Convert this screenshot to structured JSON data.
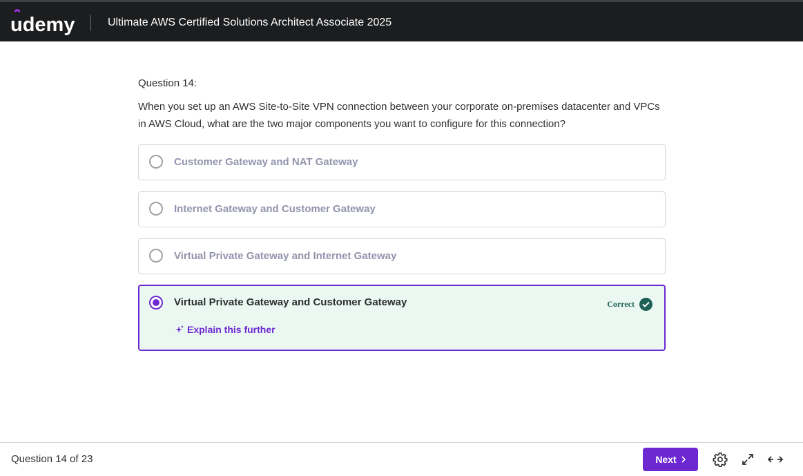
{
  "header": {
    "logo_text": "ūdemy",
    "course_title": "Ultimate AWS Certified Solutions Architect Associate 2025"
  },
  "question": {
    "label": "Question 14:",
    "text": "When you set up an AWS Site-to-Site VPN connection between your corporate on-premises datacenter and VPCs in AWS Cloud, what are the two major components you want to configure for this connection?"
  },
  "options": [
    {
      "label": "Customer Gateway and NAT Gateway",
      "selected": false
    },
    {
      "label": "Internet Gateway and Customer Gateway",
      "selected": false
    },
    {
      "label": "Virtual Private Gateway and Internet Gateway",
      "selected": false
    },
    {
      "label": "Virtual Private Gateway and Customer Gateway",
      "selected": true,
      "status": "Correct",
      "explain_link": "Explain this further"
    }
  ],
  "footer": {
    "progress": "Question 14 of 23",
    "next_label": "Next",
    "icons": [
      "gear-icon",
      "expand-icon",
      "horizontal-arrows-icon"
    ]
  },
  "colors": {
    "accent": "#6d28d2",
    "correct": "#1e6055",
    "correct_bg": "#ebf8f2",
    "header_bg": "#1c1d1f"
  }
}
